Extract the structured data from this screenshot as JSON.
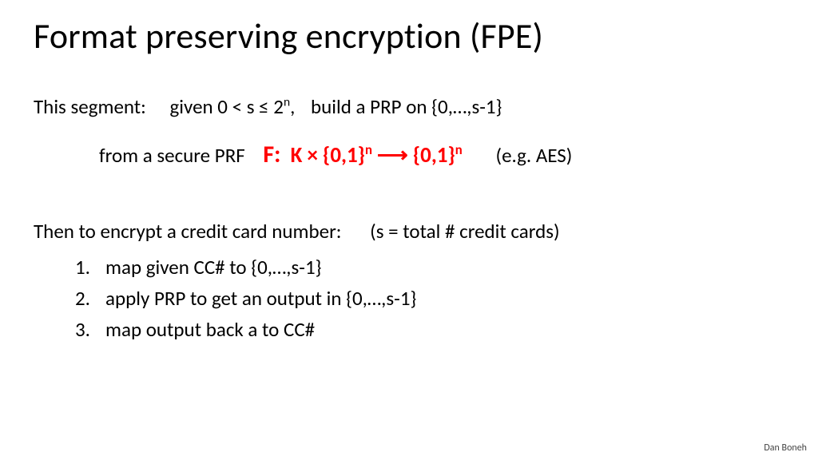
{
  "title": "Format preserving encryption (FPE)",
  "segment": {
    "label": "This segment:",
    "given": "given 0 < s ≤ 2",
    "given_sup": "n",
    "given_tail": ",",
    "build": "build a PRP on  {0,…,s-1}"
  },
  "prf": {
    "from": "from  a secure PRF",
    "f_label": "F:",
    "formula_1": "K × {0,1}",
    "formula_sup1": "n",
    "arrow": " ⟶ ",
    "formula_2": "{0,1}",
    "formula_sup2": "n",
    "example": "(e.g. AES)"
  },
  "then": {
    "label": "Then to encrypt a credit card number:",
    "note": "(s = total # credit cards)"
  },
  "steps": [
    {
      "n": "1.",
      "text": "map given CC# to {0,…,s-1}"
    },
    {
      "n": "2.",
      "text": "apply PRP to get an output in {0,…,s-1}"
    },
    {
      "n": "3.",
      "text": "map output back a to CC#"
    }
  ],
  "footer": "Dan Boneh"
}
